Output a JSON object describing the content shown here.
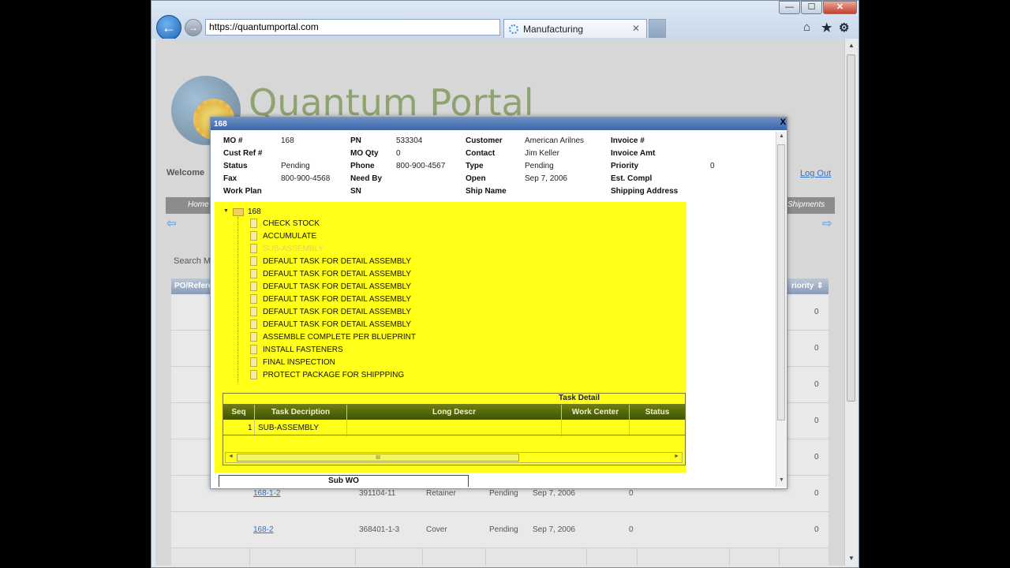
{
  "browser": {
    "address": "https://quantumportal.com",
    "tab_title": "Manufacturing",
    "win_min": "—",
    "win_max": "☐",
    "win_close": "✕"
  },
  "portal": {
    "logo_text": "Quantum Portal",
    "welcome": "Welcome",
    "logout": "Log Out",
    "nav_home": "Home",
    "nav_shipments": "Shipments",
    "search_label": "Search M",
    "grid_col_po": "PO/Refere",
    "grid_col_priority": "riority",
    "grid_rows": [
      {
        "priority": "0"
      },
      {
        "priority": "0"
      },
      {
        "priority": "0"
      },
      {
        "priority": "0"
      },
      {
        "priority": "0"
      },
      {
        "priority": "0",
        "mo": "168-1-2",
        "pn": "391104-11",
        "desc": "Retainer",
        "status": "Pending",
        "date": "Sep 7, 2006",
        "qty": "0"
      },
      {
        "priority": "0",
        "mo": "168-2",
        "pn": "368401-1-3",
        "desc": "Cover",
        "status": "Pending",
        "date": "Sep 7, 2006",
        "qty": "0"
      }
    ]
  },
  "modal": {
    "title": "168",
    "close": "X",
    "fields": {
      "mo_label": "MO #",
      "mo_value": "168",
      "custref_label": "Cust Ref #",
      "status_label": "Status",
      "status_value": "Pending",
      "fax_label": "Fax",
      "fax_value": "800-900-4568",
      "workplan_label": "Work Plan",
      "pn_label": "PN",
      "pn_value": "533304",
      "moqty_label": "MO Qty",
      "moqty_value": "0",
      "phone_label": "Phone",
      "phone_value": "800-900-4567",
      "needby_label": "Need By",
      "sn_label": "SN",
      "customer_label": "Customer",
      "customer_value": "American Arilnes",
      "contact_label": "Contact",
      "contact_value": "Jim Keller",
      "type_label": "Type",
      "type_value": "Pending",
      "open_label": "Open",
      "open_value": "Sep 7, 2006",
      "shipname_label": "Ship Name",
      "invoice_label": "Invoice #",
      "invamt_label": "Invoice Amt",
      "priority_label": "Priority",
      "priority_value": "0",
      "estcompl_label": "Est. Compl",
      "shipaddr_label": "Shipping Address"
    },
    "tree": {
      "root": "168",
      "items": [
        "CHECK STOCK",
        "ACCUMULATE",
        "SUB-ASSEMBLY",
        "DEFAULT TASK FOR DETAIL ASSEMBLY",
        "DEFAULT TASK FOR DETAIL ASSEMBLY",
        "DEFAULT TASK FOR DETAIL ASSEMBLY",
        "DEFAULT TASK FOR DETAIL ASSEMBLY",
        "DEFAULT TASK FOR DETAIL ASSEMBLY",
        "DEFAULT TASK FOR DETAIL ASSEMBLY",
        "ASSEMBLE COMPLETE PER BLUEPRINT",
        "INSTALL FASTENERS",
        "FINAL INSPECTION",
        "PROTECT PACKAGE FOR SHIPPPING"
      ]
    },
    "task_detail": {
      "caption": "Task Detail",
      "col_seq": "Seq",
      "col_task": "Task Decription",
      "col_long": "Long Descr",
      "col_wc": "Work Center",
      "col_status": "Status",
      "row_seq": "1",
      "row_task": "SUB-ASSEMBLY",
      "scroll_grip": "III"
    },
    "subwo": "Sub WO"
  },
  "colors": {
    "tree_bg": "#ffff1a",
    "header_green": "#4f6408",
    "title_blue": "#4a74b4"
  }
}
